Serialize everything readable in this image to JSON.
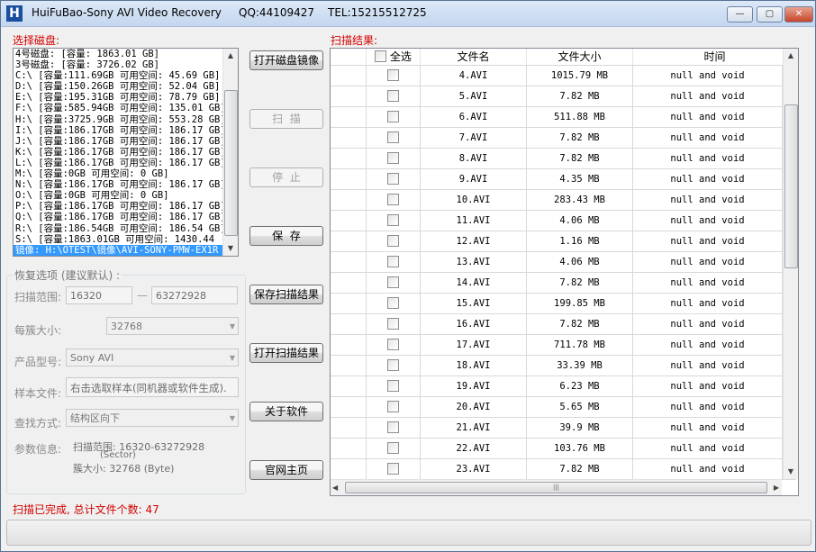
{
  "window": {
    "title": "HuiFuBao-Sony AVI Video Recovery",
    "qq": "QQ:44109427",
    "tel": "TEL:15215512725",
    "controls": {
      "minimize": "—",
      "maximize": "▢",
      "close": "✕"
    }
  },
  "disk_panel": {
    "label": "选择磁盘:",
    "items": [
      "4号磁盘: [容量: 1863.01 GB]",
      "3号磁盘: [容量: 3726.02 GB]",
      "C:\\ [容量:111.69GB 可用空间: 45.69 GB]",
      "D:\\ [容量:150.26GB 可用空间: 52.04 GB]",
      "E:\\ [容量:195.31GB 可用空间: 78.79 GB]",
      "F:\\ [容量:585.94GB 可用空间: 135.01 GB]",
      "H:\\ [容量:3725.9GB 可用空间: 553.28 GB]",
      "I:\\ [容量:186.17GB 可用空间: 186.17 GB]",
      "J:\\ [容量:186.17GB 可用空间: 186.17 GB]",
      "K:\\ [容量:186.17GB 可用空间: 186.17 GB]",
      "L:\\ [容量:186.17GB 可用空间: 186.17 GB]",
      "M:\\ [容量:0GB 可用空间: 0 GB]",
      "N:\\ [容量:186.17GB 可用空间: 186.17 GB]",
      "O:\\ [容量:0GB 可用空间: 0 GB]",
      "P:\\ [容量:186.17GB 可用空间: 186.17 GB]",
      "Q:\\ [容量:186.17GB 可用空间: 186.17 GB]",
      "R:\\ [容量:186.54GB 可用空间: 186.54 GB]",
      "S:\\ [容量:1863.01GB 可用空间: 1430.44",
      "镜像: H:\\OTEST\\镜像\\AVI-SONY-PMW-EX1R"
    ],
    "selected_index": 18
  },
  "options": {
    "group_title": "恢复选项 (建议默认) :",
    "scan_range_label": "扫描范围:",
    "scan_range_start": "16320",
    "scan_range_dash": "—",
    "scan_range_end": "63272928",
    "cluster_label": "每簇大小:",
    "cluster_value": "32768",
    "product_label": "产品型号:",
    "product_value": "Sony AVI",
    "sample_label": "样本文件:",
    "sample_value": "右击选取样本(同机器或软件生成).",
    "search_label": "查找方式:",
    "search_value": "结构区向下",
    "param_label": "参数信息:",
    "param_line1": "扫描范围: 16320-63272928",
    "param_line2": "(Sector)",
    "param_line3": "簇大小: 32768 (Byte)"
  },
  "buttons": {
    "open_image": "打开磁盘镜像",
    "scan": "扫  描",
    "stop": "停  止",
    "save": "保  存",
    "save_result": "保存扫描结果",
    "open_result": "打开扫描结果",
    "about": "关于软件",
    "homepage": "官网主页"
  },
  "results": {
    "label": "扫描结果:",
    "headers": {
      "select_all": "全选",
      "filename": "文件名",
      "filesize": "文件大小",
      "time": "时间"
    },
    "rows": [
      {
        "name": "4.AVI",
        "size": "1015.79 MB",
        "time": "null and void"
      },
      {
        "name": "5.AVI",
        "size": "7.82 MB",
        "time": "null and void"
      },
      {
        "name": "6.AVI",
        "size": "511.88 MB",
        "time": "null and void"
      },
      {
        "name": "7.AVI",
        "size": "7.82 MB",
        "time": "null and void"
      },
      {
        "name": "8.AVI",
        "size": "7.82 MB",
        "time": "null and void"
      },
      {
        "name": "9.AVI",
        "size": "4.35 MB",
        "time": "null and void"
      },
      {
        "name": "10.AVI",
        "size": "283.43 MB",
        "time": "null and void"
      },
      {
        "name": "11.AVI",
        "size": "4.06 MB",
        "time": "null and void"
      },
      {
        "name": "12.AVI",
        "size": "1.16 MB",
        "time": "null and void"
      },
      {
        "name": "13.AVI",
        "size": "4.06 MB",
        "time": "null and void"
      },
      {
        "name": "14.AVI",
        "size": "7.82 MB",
        "time": "null and void"
      },
      {
        "name": "15.AVI",
        "size": "199.85 MB",
        "time": "null and void"
      },
      {
        "name": "16.AVI",
        "size": "7.82 MB",
        "time": "null and void"
      },
      {
        "name": "17.AVI",
        "size": "711.78 MB",
        "time": "null and void"
      },
      {
        "name": "18.AVI",
        "size": "33.39 MB",
        "time": "null and void"
      },
      {
        "name": "19.AVI",
        "size": "6.23 MB",
        "time": "null and void"
      },
      {
        "name": "20.AVI",
        "size": "5.65 MB",
        "time": "null and void"
      },
      {
        "name": "21.AVI",
        "size": "39.9 MB",
        "time": "null and void"
      },
      {
        "name": "22.AVI",
        "size": "103.76 MB",
        "time": "null and void"
      },
      {
        "name": "23.AVI",
        "size": "7.82 MB",
        "time": "null and void"
      }
    ]
  },
  "status_text": "扫描已完成, 总计文件个数: 47",
  "colors": {
    "accent_red": "#d40000",
    "selection_blue": "#3399ff"
  }
}
